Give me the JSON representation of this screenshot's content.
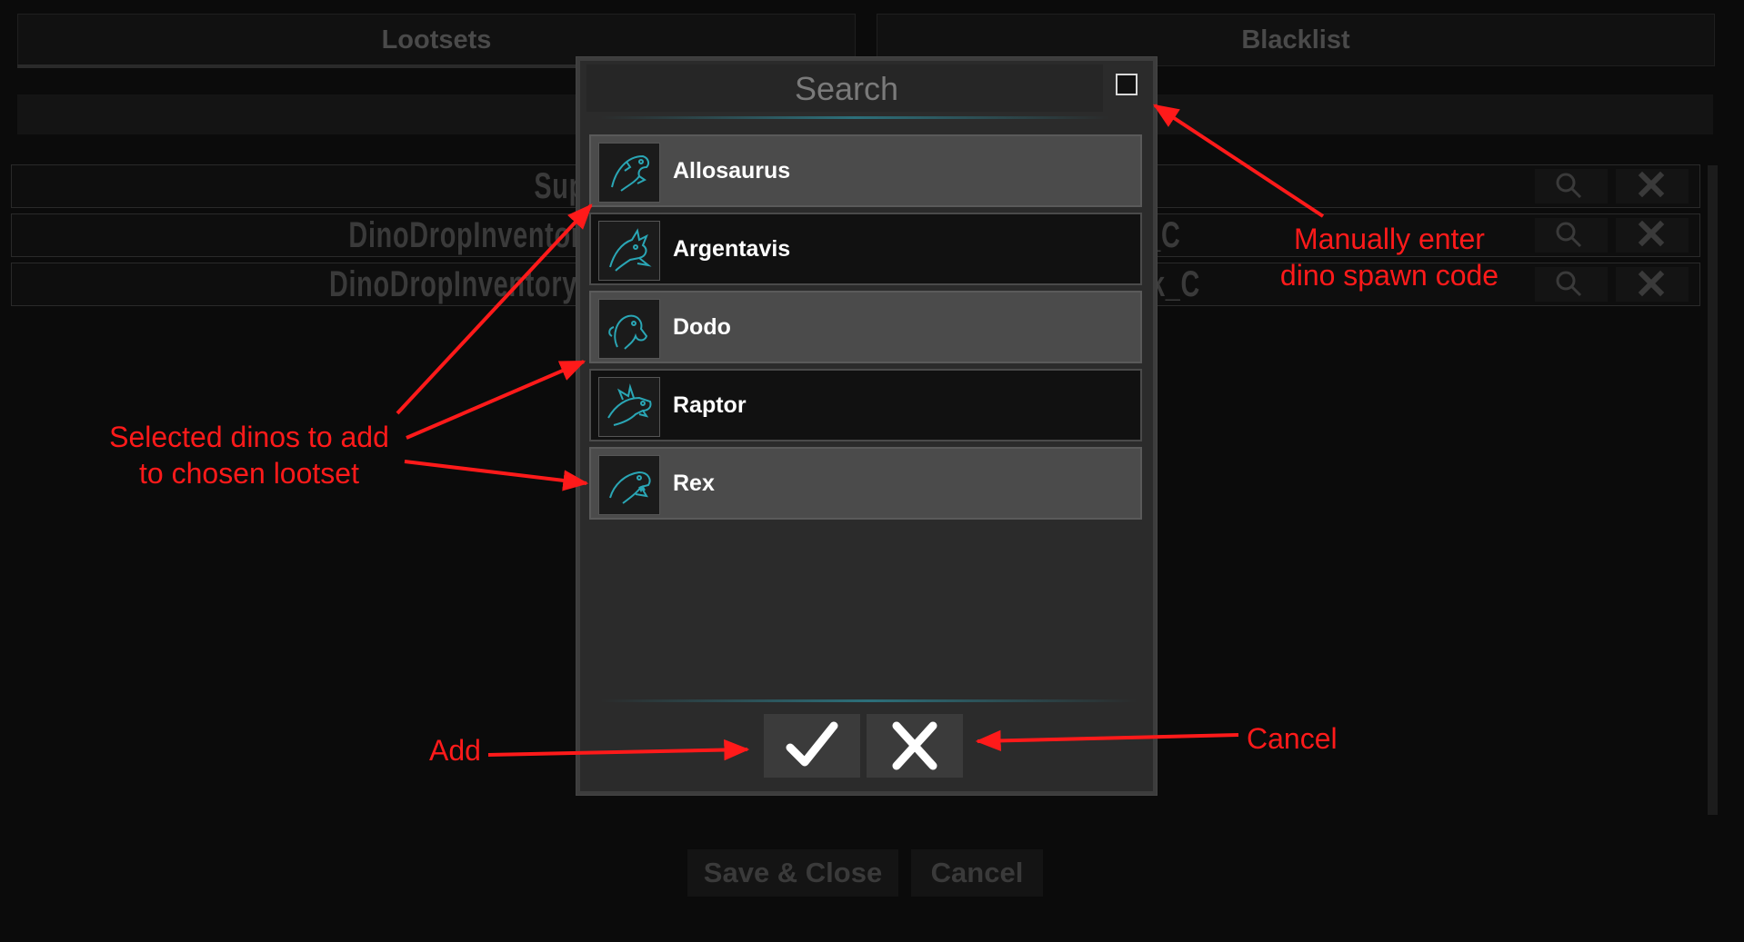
{
  "tabs": [
    "Lootsets",
    "Blacklist"
  ],
  "background_rows": [
    "SupplyCrate_OceanInstant_High_C",
    "DinoDropInventoryComponent_BossDragon_Easy_Ragnarok_C",
    "DinoDropInventoryComponent_BossDragon_Medium_Ragnarok_C"
  ],
  "background_buttons": {
    "save_close": "Save & Close",
    "cancel": "Cancel"
  },
  "dialog": {
    "search_placeholder": "Search",
    "dinos": [
      {
        "name": "Allosaurus",
        "selected": true
      },
      {
        "name": "Argentavis",
        "selected": false
      },
      {
        "name": "Dodo",
        "selected": true
      },
      {
        "name": "Raptor",
        "selected": false
      },
      {
        "name": "Rex",
        "selected": true
      }
    ],
    "confirm_icon": "checkmark-icon",
    "cancel_icon": "close-icon"
  },
  "annotations": {
    "manual_line1": "Manually enter",
    "manual_line2": "dino spawn code",
    "selected_line1": "Selected dinos to add",
    "selected_line2": "to chosen lootset",
    "add": "Add",
    "cancel": "Cancel"
  },
  "colors": {
    "annotation": "#ff1a1a",
    "accent_teal": "#2aa6b5"
  }
}
